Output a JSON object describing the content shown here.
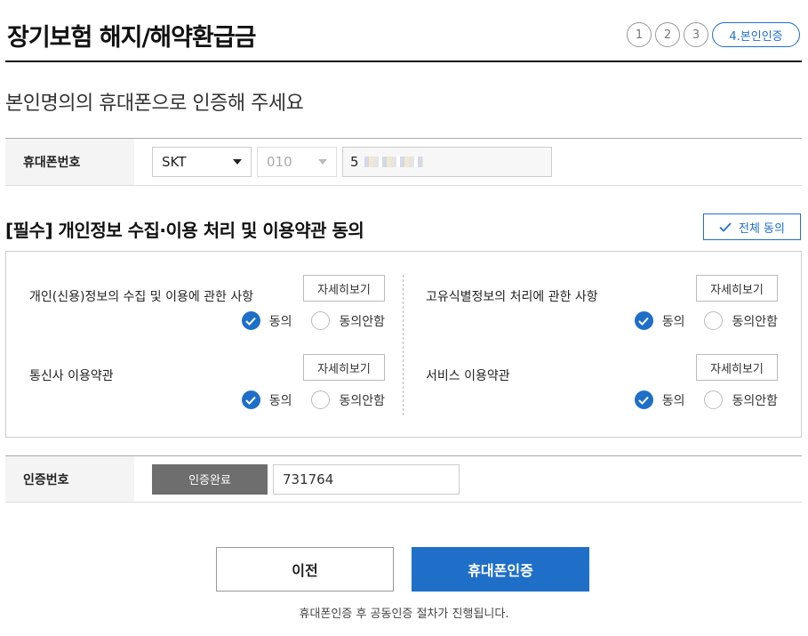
{
  "header": {
    "title": "장기보험 해지/해약환급금",
    "steps": [
      "1",
      "2",
      "3"
    ],
    "current_step": "4.본인인증"
  },
  "subtitle": "본인명의의 휴대폰으로 인증해 주세요",
  "phone": {
    "label": "휴대폰번호",
    "carrier": "SKT",
    "prefix": "010",
    "number_visible": "5"
  },
  "agreement": {
    "title": "[필수] 개인정보 수집·이용 처리 및 이용약관 동의",
    "all_agree_label": "전체 동의",
    "detail_label": "자세히보기",
    "agree_label": "동의",
    "disagree_label": "동의안함",
    "items": [
      {
        "title": "개인(신용)정보의 수집 및 이용에 관한 사항",
        "agreed": true
      },
      {
        "title": "고유식별정보의 처리에 관한 사항",
        "agreed": true
      },
      {
        "title": "통신사 이용약관",
        "agreed": true
      },
      {
        "title": "서비스 이용약관",
        "agreed": true
      }
    ]
  },
  "cert": {
    "label": "인증번호",
    "status_button": "인증완료",
    "code": "731764"
  },
  "actions": {
    "prev_label": "이전",
    "submit_label": "휴대폰인증",
    "notice": "휴대폰인증 후 공동인증 절차가 진행됩니다."
  },
  "colors": {
    "accent": "#1f6fc9",
    "done_button": "#6e6e6e"
  }
}
